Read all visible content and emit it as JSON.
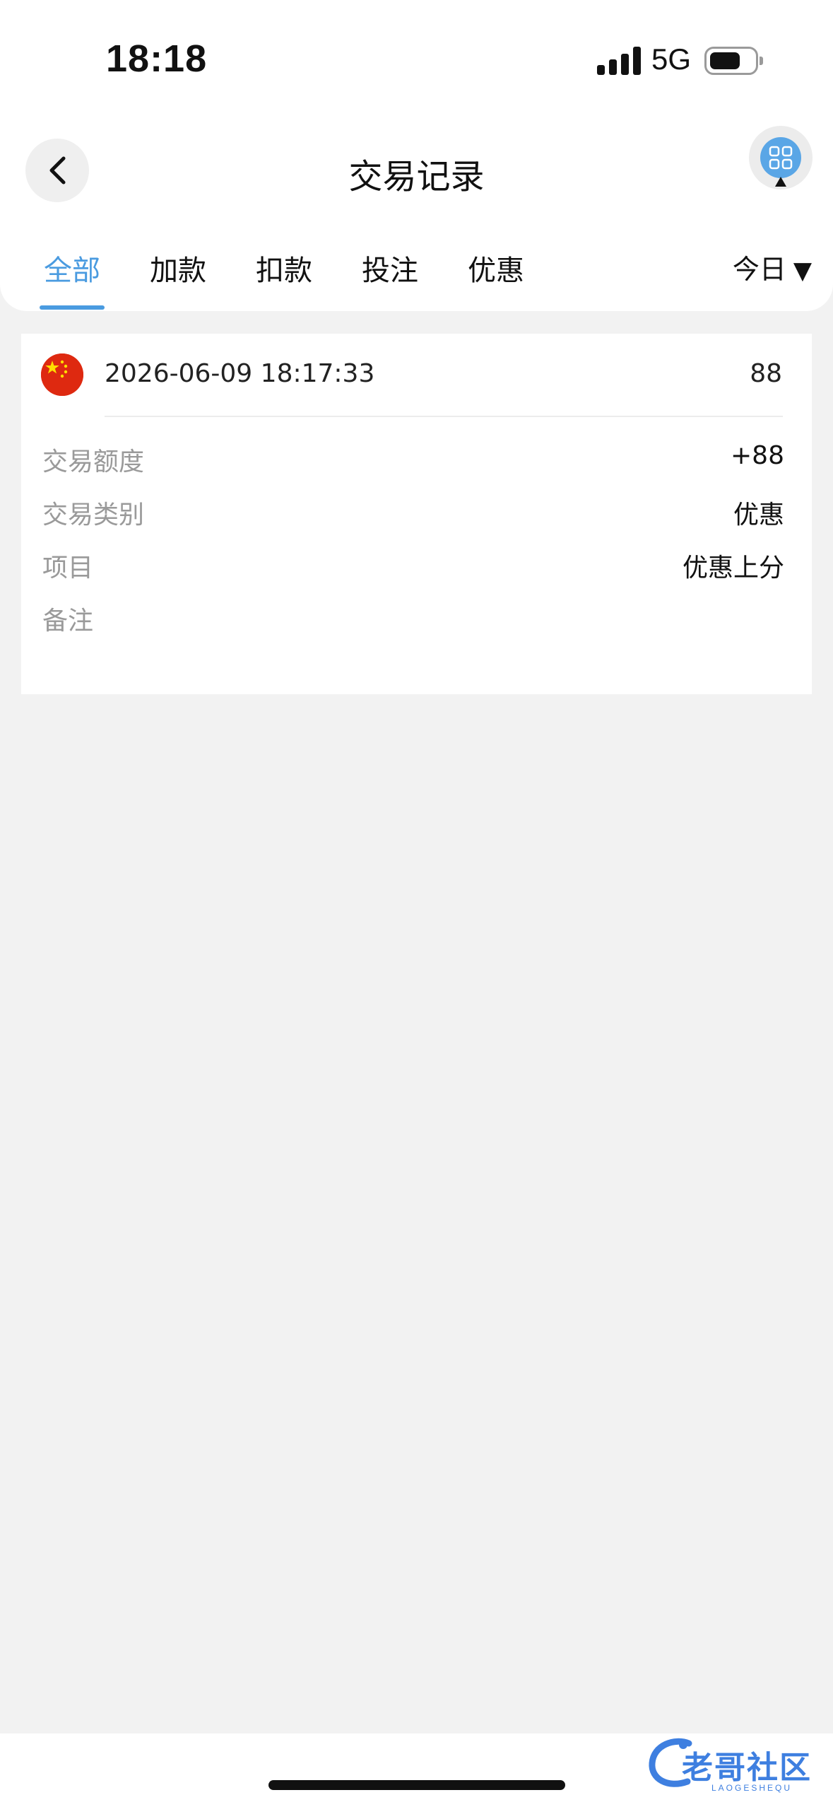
{
  "status_bar": {
    "time": "18:18",
    "network": "5G"
  },
  "header": {
    "title": "交易记录",
    "back_icon": "chevron-left-icon",
    "menu_icon": "grid-icon"
  },
  "tabs": [
    {
      "label": "全部",
      "active": true
    },
    {
      "label": "加款",
      "active": false
    },
    {
      "label": "扣款",
      "active": false
    },
    {
      "label": "投注",
      "active": false
    },
    {
      "label": "优惠",
      "active": false
    }
  ],
  "filter": {
    "label": "今日",
    "arrow": "▼"
  },
  "record": {
    "flag_icon": "china-flag-icon",
    "datetime": "2026-06-09 18:17:33",
    "amount": "88",
    "fields": [
      {
        "label": "交易额度",
        "value": "+88"
      },
      {
        "label": "交易类别",
        "value": "优惠"
      },
      {
        "label": "项目",
        "value": "优惠上分"
      },
      {
        "label": "备注",
        "value": ""
      }
    ]
  },
  "watermark": {
    "text": "老哥社区",
    "sub": "LAOGESHEQU"
  },
  "colors": {
    "accent": "#4a9be0",
    "background": "#f2f2f2",
    "label": "#9a9a9a"
  }
}
